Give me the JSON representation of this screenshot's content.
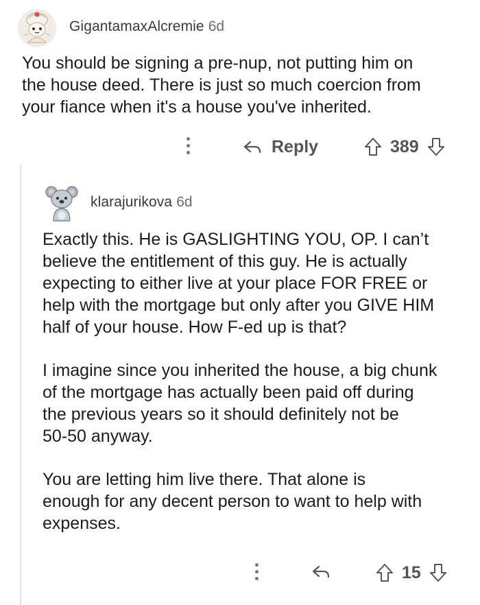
{
  "comment1": {
    "username": "GigantamaxAlcremie",
    "timestamp": "6d",
    "body_lines": [
      "You should be signing a pre-nup, not putting him on",
      "the house deed. There is just so much coercion from",
      "your fiance when it's a house you've inherited."
    ],
    "reply_label": "Reply",
    "score": "389"
  },
  "comment2": {
    "username": "klarajurikova",
    "timestamp": "6d",
    "paragraphs": [
      [
        "Exactly this. He is GASLIGHTING YOU, OP. I can’t",
        "believe the entitlement of this guy. He is actually",
        "expecting to either live at your place FOR FREE or",
        "help with the mortgage but only after you GIVE HIM",
        "half of your house. How F-ed up is that?"
      ],
      [
        "I imagine since you inherited the house, a big chunk",
        "of the mortgage has actually been paid off during",
        "the previous years so it should definitely not be",
        "50-50 anyway."
      ],
      [
        "You are letting him live there. That alone is",
        "enough for any decent person to want to help with",
        "expenses."
      ]
    ],
    "score": "15"
  },
  "icons": {
    "more": "more-options-icon",
    "reply": "reply-arrow-icon",
    "upvote": "upvote-arrow-icon",
    "downvote": "downvote-arrow-icon"
  }
}
